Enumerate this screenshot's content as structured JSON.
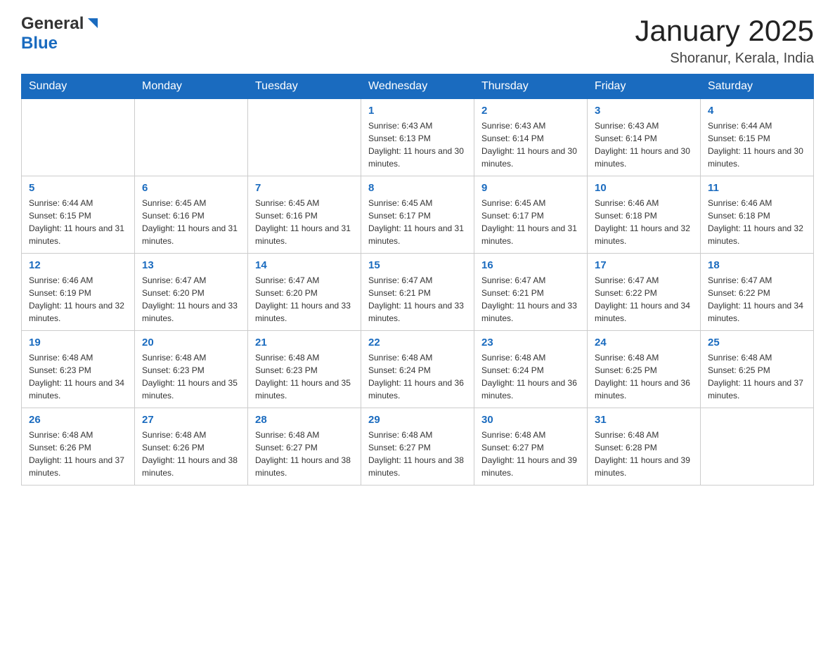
{
  "header": {
    "logo_general": "General",
    "logo_triangle": "▶",
    "logo_blue": "Blue",
    "month_title": "January 2025",
    "location": "Shoranur, Kerala, India"
  },
  "days_of_week": [
    "Sunday",
    "Monday",
    "Tuesday",
    "Wednesday",
    "Thursday",
    "Friday",
    "Saturday"
  ],
  "weeks": [
    [
      {
        "day": "",
        "info": ""
      },
      {
        "day": "",
        "info": ""
      },
      {
        "day": "",
        "info": ""
      },
      {
        "day": "1",
        "info": "Sunrise: 6:43 AM\nSunset: 6:13 PM\nDaylight: 11 hours and 30 minutes."
      },
      {
        "day": "2",
        "info": "Sunrise: 6:43 AM\nSunset: 6:14 PM\nDaylight: 11 hours and 30 minutes."
      },
      {
        "day": "3",
        "info": "Sunrise: 6:43 AM\nSunset: 6:14 PM\nDaylight: 11 hours and 30 minutes."
      },
      {
        "day": "4",
        "info": "Sunrise: 6:44 AM\nSunset: 6:15 PM\nDaylight: 11 hours and 30 minutes."
      }
    ],
    [
      {
        "day": "5",
        "info": "Sunrise: 6:44 AM\nSunset: 6:15 PM\nDaylight: 11 hours and 31 minutes."
      },
      {
        "day": "6",
        "info": "Sunrise: 6:45 AM\nSunset: 6:16 PM\nDaylight: 11 hours and 31 minutes."
      },
      {
        "day": "7",
        "info": "Sunrise: 6:45 AM\nSunset: 6:16 PM\nDaylight: 11 hours and 31 minutes."
      },
      {
        "day": "8",
        "info": "Sunrise: 6:45 AM\nSunset: 6:17 PM\nDaylight: 11 hours and 31 minutes."
      },
      {
        "day": "9",
        "info": "Sunrise: 6:45 AM\nSunset: 6:17 PM\nDaylight: 11 hours and 31 minutes."
      },
      {
        "day": "10",
        "info": "Sunrise: 6:46 AM\nSunset: 6:18 PM\nDaylight: 11 hours and 32 minutes."
      },
      {
        "day": "11",
        "info": "Sunrise: 6:46 AM\nSunset: 6:18 PM\nDaylight: 11 hours and 32 minutes."
      }
    ],
    [
      {
        "day": "12",
        "info": "Sunrise: 6:46 AM\nSunset: 6:19 PM\nDaylight: 11 hours and 32 minutes."
      },
      {
        "day": "13",
        "info": "Sunrise: 6:47 AM\nSunset: 6:20 PM\nDaylight: 11 hours and 33 minutes."
      },
      {
        "day": "14",
        "info": "Sunrise: 6:47 AM\nSunset: 6:20 PM\nDaylight: 11 hours and 33 minutes."
      },
      {
        "day": "15",
        "info": "Sunrise: 6:47 AM\nSunset: 6:21 PM\nDaylight: 11 hours and 33 minutes."
      },
      {
        "day": "16",
        "info": "Sunrise: 6:47 AM\nSunset: 6:21 PM\nDaylight: 11 hours and 33 minutes."
      },
      {
        "day": "17",
        "info": "Sunrise: 6:47 AM\nSunset: 6:22 PM\nDaylight: 11 hours and 34 minutes."
      },
      {
        "day": "18",
        "info": "Sunrise: 6:47 AM\nSunset: 6:22 PM\nDaylight: 11 hours and 34 minutes."
      }
    ],
    [
      {
        "day": "19",
        "info": "Sunrise: 6:48 AM\nSunset: 6:23 PM\nDaylight: 11 hours and 34 minutes."
      },
      {
        "day": "20",
        "info": "Sunrise: 6:48 AM\nSunset: 6:23 PM\nDaylight: 11 hours and 35 minutes."
      },
      {
        "day": "21",
        "info": "Sunrise: 6:48 AM\nSunset: 6:23 PM\nDaylight: 11 hours and 35 minutes."
      },
      {
        "day": "22",
        "info": "Sunrise: 6:48 AM\nSunset: 6:24 PM\nDaylight: 11 hours and 36 minutes."
      },
      {
        "day": "23",
        "info": "Sunrise: 6:48 AM\nSunset: 6:24 PM\nDaylight: 11 hours and 36 minutes."
      },
      {
        "day": "24",
        "info": "Sunrise: 6:48 AM\nSunset: 6:25 PM\nDaylight: 11 hours and 36 minutes."
      },
      {
        "day": "25",
        "info": "Sunrise: 6:48 AM\nSunset: 6:25 PM\nDaylight: 11 hours and 37 minutes."
      }
    ],
    [
      {
        "day": "26",
        "info": "Sunrise: 6:48 AM\nSunset: 6:26 PM\nDaylight: 11 hours and 37 minutes."
      },
      {
        "day": "27",
        "info": "Sunrise: 6:48 AM\nSunset: 6:26 PM\nDaylight: 11 hours and 38 minutes."
      },
      {
        "day": "28",
        "info": "Sunrise: 6:48 AM\nSunset: 6:27 PM\nDaylight: 11 hours and 38 minutes."
      },
      {
        "day": "29",
        "info": "Sunrise: 6:48 AM\nSunset: 6:27 PM\nDaylight: 11 hours and 38 minutes."
      },
      {
        "day": "30",
        "info": "Sunrise: 6:48 AM\nSunset: 6:27 PM\nDaylight: 11 hours and 39 minutes."
      },
      {
        "day": "31",
        "info": "Sunrise: 6:48 AM\nSunset: 6:28 PM\nDaylight: 11 hours and 39 minutes."
      },
      {
        "day": "",
        "info": ""
      }
    ]
  ]
}
